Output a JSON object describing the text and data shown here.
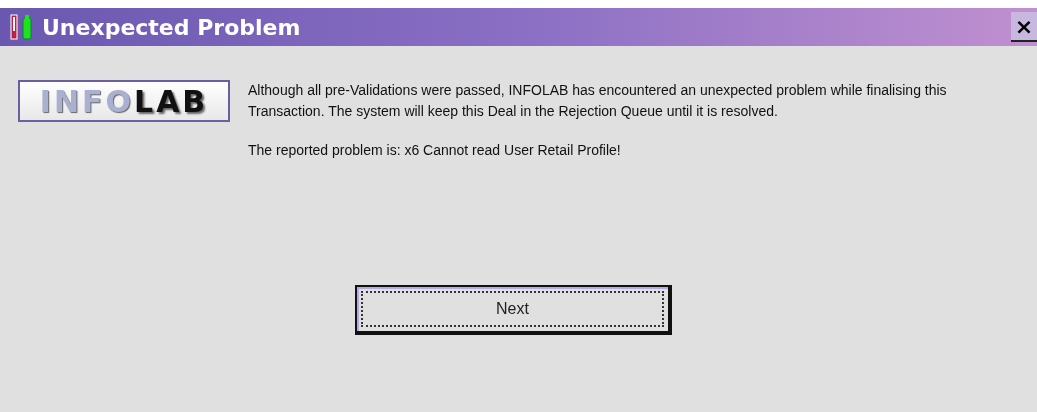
{
  "window": {
    "title": "Unexpected Problem",
    "close": "×"
  },
  "logo": {
    "light": "INFO",
    "dark": "LAB"
  },
  "message": [
    "Although all pre-Validations were passed, INFOLAB has encountered an unexpected problem while finalising this Transaction. The system will keep this Deal in the Rejection Queue until it is resolved.",
    "The reported problem is: x6 Cannot read User Retail Profile!"
  ],
  "buttons": [
    {
      "label": "Next",
      "focused": true
    }
  ]
}
